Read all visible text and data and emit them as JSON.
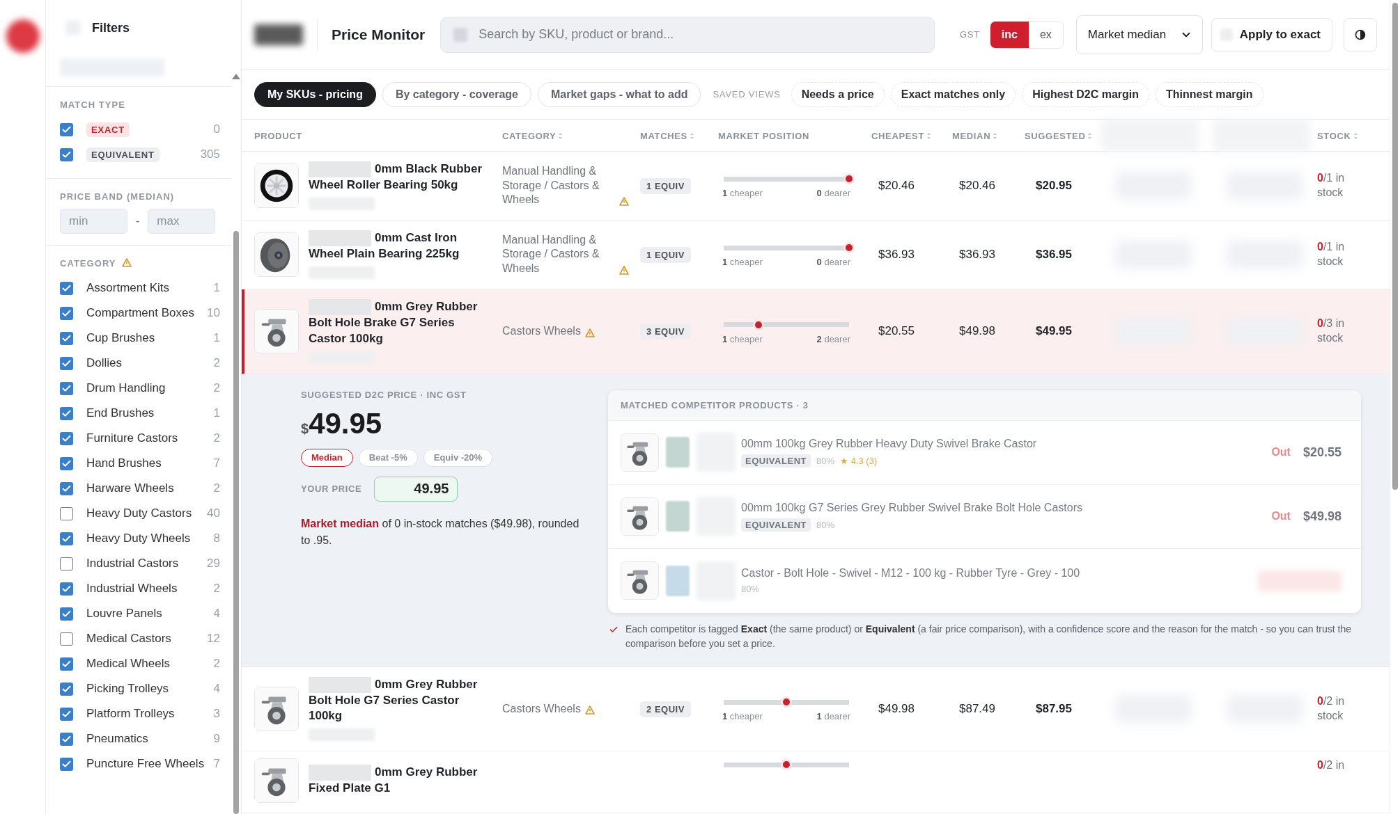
{
  "sidebar": {
    "title": "Filters",
    "match_type": {
      "heading": "MATCH TYPE",
      "items": [
        {
          "label": "EXACT",
          "kind": "exact",
          "checked": true,
          "count": "0"
        },
        {
          "label": "EQUIVALENT",
          "kind": "equivalent",
          "checked": true,
          "count": "305"
        }
      ]
    },
    "price_band": {
      "heading": "PRICE BAND (MEDIAN)",
      "fields": [
        {
          "placeholder": "min"
        },
        {
          "placeholder": "max"
        }
      ],
      "separator": "-"
    },
    "category": {
      "heading": "CATEGORY",
      "warning": true,
      "items": [
        {
          "label": "Assortment Kits",
          "checked": true,
          "count": "1"
        },
        {
          "label": "Compartment Boxes",
          "checked": true,
          "count": "10"
        },
        {
          "label": "Cup Brushes",
          "checked": true,
          "count": "1"
        },
        {
          "label": "Dollies",
          "checked": true,
          "count": "2"
        },
        {
          "label": "Drum Handling",
          "checked": true,
          "count": "2"
        },
        {
          "label": "End Brushes",
          "checked": true,
          "count": "1"
        },
        {
          "label": "Furniture Castors",
          "checked": true,
          "count": "2"
        },
        {
          "label": "Hand Brushes",
          "checked": true,
          "count": "7"
        },
        {
          "label": "Harware Wheels",
          "checked": true,
          "count": "2"
        },
        {
          "label": "Heavy Duty Castors",
          "checked": false,
          "count": "40"
        },
        {
          "label": "Heavy Duty Wheels",
          "checked": true,
          "count": "8"
        },
        {
          "label": "Industrial Castors",
          "checked": false,
          "count": "29"
        },
        {
          "label": "Industrial Wheels",
          "checked": true,
          "count": "2"
        },
        {
          "label": "Louvre Panels",
          "checked": true,
          "count": "4"
        },
        {
          "label": "Medical Castors",
          "checked": false,
          "count": "12"
        },
        {
          "label": "Medical Wheels",
          "checked": true,
          "count": "2"
        },
        {
          "label": "Picking Trolleys",
          "checked": true,
          "count": "4"
        },
        {
          "label": "Platform Trolleys",
          "checked": true,
          "count": "3"
        },
        {
          "label": "Pneumatics",
          "checked": true,
          "count": "9"
        },
        {
          "label": "Puncture Free Wheels",
          "checked": true,
          "count": "7"
        }
      ]
    }
  },
  "header": {
    "title": "Price Monitor",
    "search": {
      "placeholder": "Search by SKU, product or brand..."
    },
    "gst": {
      "label": "GST",
      "options": [
        {
          "label": "inc",
          "selected": true
        },
        {
          "label": "ex",
          "selected": false
        }
      ]
    },
    "basis": {
      "value": "Market median"
    },
    "apply_button": "Apply to exact"
  },
  "views": {
    "tabs": [
      {
        "label": "My SKUs - pricing",
        "selected": true
      },
      {
        "label": "By category - coverage",
        "selected": false
      },
      {
        "label": "Market gaps - what to add",
        "selected": false
      }
    ],
    "saved_label": "SAVED VIEWS",
    "saved": [
      "Needs a price",
      "Exact matches only",
      "Highest D2C margin",
      "Thinnest margin"
    ]
  },
  "table": {
    "columns": [
      {
        "kind": "text",
        "label": "PRODUCT",
        "sortable": false
      },
      {
        "kind": "text",
        "label": "CATEGORY",
        "sortable": true
      },
      {
        "kind": "text",
        "label": "MATCHES",
        "sortable": true
      },
      {
        "kind": "text",
        "label": "MARKET POSITION",
        "sortable": false
      },
      {
        "kind": "text",
        "label": "CHEAPEST",
        "sortable": true
      },
      {
        "kind": "text",
        "label": "MEDIAN",
        "sortable": true
      },
      {
        "kind": "text",
        "label": "SUGGESTED",
        "sortable": true
      },
      {
        "kind": "hidden"
      },
      {
        "kind": "hidden"
      },
      {
        "kind": "text",
        "label": "STOCK",
        "sortable": true
      }
    ],
    "rows": [
      {
        "name": "0mm Black Rubber Wheel Roller Bearing 50kg",
        "category": "Manual Handling & Storage / Castors & Wheels",
        "category_warning": true,
        "matches": "1 EQUIV",
        "position": {
          "level": 1,
          "cheaper": "**1** cheaper",
          "dearer": "**0** dearer"
        },
        "cheapest": "$20.46",
        "median": "$20.46",
        "suggested": "$20.95",
        "stock_out": "0",
        "stock_rest": "/1 in stock",
        "selected": false
      },
      {
        "name": "0mm Cast Iron Wheel Plain Bearing 225kg",
        "category": "Manual Handling & Storage / Castors & Wheels",
        "category_warning": true,
        "matches": "1 EQUIV",
        "position": {
          "level": 1,
          "cheaper": "**1** cheaper",
          "dearer": "**0** dearer"
        },
        "cheapest": "$36.93",
        "median": "$36.93",
        "suggested": "$36.95",
        "stock_out": "0",
        "stock_rest": "/1 in stock",
        "selected": false
      },
      {
        "name": "0mm Grey Rubber Bolt Hole Brake G7 Series Castor 100kg",
        "category": "Castors Wheels",
        "category_warning": true,
        "matches": "3 EQUIV",
        "position": {
          "level": 0.28,
          "cheaper": "**1** cheaper",
          "dearer": "**2** dearer"
        },
        "cheapest": "$20.55",
        "median": "$49.98",
        "suggested": "$49.95",
        "stock_out": "0",
        "stock_rest": "/3 in stock",
        "selected": true,
        "detail": {
          "label": "SUGGESTED D2C PRICE · INC GST",
          "currency": "$",
          "amount": "49.95",
          "methods": [
            {
              "label": "Median",
              "selected": true
            },
            {
              "label": "Beat -5%",
              "selected": false
            },
            {
              "label": "Equiv -20%",
              "selected": false
            }
          ],
          "your_price_label": "YOUR PRICE",
          "your_price": "49.95",
          "explanation": "**Market median** of 0 in-stock matches ($49.98), rounded to .95.",
          "competitors_heading": "MATCHED COMPETITOR PRODUCTS · 3",
          "competitors": [
            {
              "name": "00mm 100kg Grey Rubber Heavy Duty Swivel Brake Castor",
              "tag": "EQUIVALENT",
              "confidence": "80%",
              "rating": "★ 4.3 (3)",
              "status": "Out",
              "price": "$20.55"
            },
            {
              "name": "00mm 100kg G7 Series Grey Rubber Swivel Brake Bolt Hole Castors",
              "tag": "EQUIVALENT",
              "confidence": "80%",
              "status": "Out",
              "price": "$49.98"
            },
            {
              "name": "Castor - Bolt Hole - Swivel - M12 - 100 kg - Rubber Tyre - Grey - 100",
              "confidence": "80%"
            }
          ],
          "note": "Each competitor is tagged **Exact** (the same product) or **Equivalent** (a fair price comparison), with a confidence score and the reason for the match - so you can trust the comparison before you set a price."
        }
      },
      {
        "name": "0mm Grey Rubber Bolt Hole G7 Series Castor 100kg",
        "category": "Castors Wheels",
        "category_warning": true,
        "matches": "2 EQUIV",
        "position": {
          "level": 0.5,
          "cheaper": "**1** cheaper",
          "dearer": "**1** dearer"
        },
        "cheapest": "$49.98",
        "median": "$87.49",
        "suggested": "$87.95",
        "stock_out": "0",
        "stock_rest": "/2 in stock",
        "selected": false
      },
      {
        "name": "0mm Grey Rubber Fixed Plate G1",
        "position": {
          "level": 0.5
        },
        "stock_out": "0",
        "stock_rest": "/2 in",
        "selected": false
      }
    ]
  }
}
